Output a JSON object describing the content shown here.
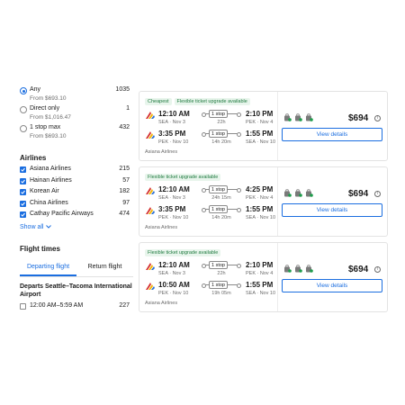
{
  "stops_filter": {
    "options": [
      {
        "label": "Any",
        "sub": "",
        "count": "1035",
        "checked": true
      },
      {
        "label": "Direct only",
        "sub": "From $1,016.47",
        "count": "1",
        "checked": false
      },
      {
        "label": "1 stop max",
        "sub": "From $693.10",
        "count": "432",
        "checked": false
      }
    ],
    "any_sub": "From $693.10"
  },
  "airlines": {
    "title": "Airlines",
    "items": [
      {
        "label": "Asiana Airlines",
        "count": "215"
      },
      {
        "label": "Hainan Airlines",
        "count": "57"
      },
      {
        "label": "Korean Air",
        "count": "182"
      },
      {
        "label": "China Airlines",
        "count": "97"
      },
      {
        "label": "Cathay Pacific Airways",
        "count": "474"
      }
    ],
    "show_all": "Show all"
  },
  "flight_times": {
    "title": "Flight times",
    "tabs": [
      "Departing flight",
      "Return flight"
    ],
    "active_tab": 0,
    "depart_title": "Departs Seattle–Tacoma International Airport",
    "slots": [
      {
        "label": "12:00 AM–5:59 AM",
        "count": "227"
      }
    ]
  },
  "results": [
    {
      "badges": [
        "Cheapest",
        "Flexible ticket upgrade available"
      ],
      "outbound": {
        "dep": "12:10 AM",
        "dep_sub": "SEA · Nov 3",
        "stop": "1 stop",
        "dur": "22h",
        "arr": "2:10 PM",
        "arr_sub": "PEK · Nov 4"
      },
      "inbound": {
        "dep": "3:35 PM",
        "dep_sub": "PEK · Nov 10",
        "stop": "1 stop",
        "dur": "14h 20m",
        "arr": "1:55 PM",
        "arr_sub": "SEA · Nov 10"
      },
      "airline": "Asiana Airlines",
      "price": "$694",
      "button": "View details"
    },
    {
      "badges": [
        "Flexible ticket upgrade available"
      ],
      "outbound": {
        "dep": "12:10 AM",
        "dep_sub": "SEA · Nov 3",
        "stop": "1 stop",
        "dur": "24h 15m",
        "arr": "4:25 PM",
        "arr_sub": "PEK · Nov 4"
      },
      "inbound": {
        "dep": "3:35 PM",
        "dep_sub": "PEK · Nov 10",
        "stop": "1 stop",
        "dur": "14h 20m",
        "arr": "1:55 PM",
        "arr_sub": "SEA · Nov 10"
      },
      "airline": "Asiana Airlines",
      "price": "$694",
      "button": "View details"
    },
    {
      "badges": [
        "Flexible ticket upgrade available"
      ],
      "outbound": {
        "dep": "12:10 AM",
        "dep_sub": "SEA · Nov 3",
        "stop": "1 stop",
        "dur": "22h",
        "arr": "2:10 PM",
        "arr_sub": "PEK · Nov 4"
      },
      "inbound": {
        "dep": "10:50 AM",
        "dep_sub": "PEK · Nov 10",
        "stop": "1 stop",
        "dur": "19h 05m",
        "arr": "1:55 PM",
        "arr_sub": "SEA · Nov 10"
      },
      "airline": "Asiana Airlines",
      "price": "$694",
      "button": "View details"
    }
  ],
  "colors": {
    "accent": "#1b6ee0",
    "badge_text": "#1f7a3f",
    "badge_bg": "#e8f5ec",
    "logo_red": "#d32f2f",
    "logo_yellow": "#f5b400"
  },
  "icons": {
    "amenities": [
      "cabin-bag-icon",
      "checked-bag-icon",
      "fee-bag-icon"
    ],
    "info": "info-icon"
  }
}
